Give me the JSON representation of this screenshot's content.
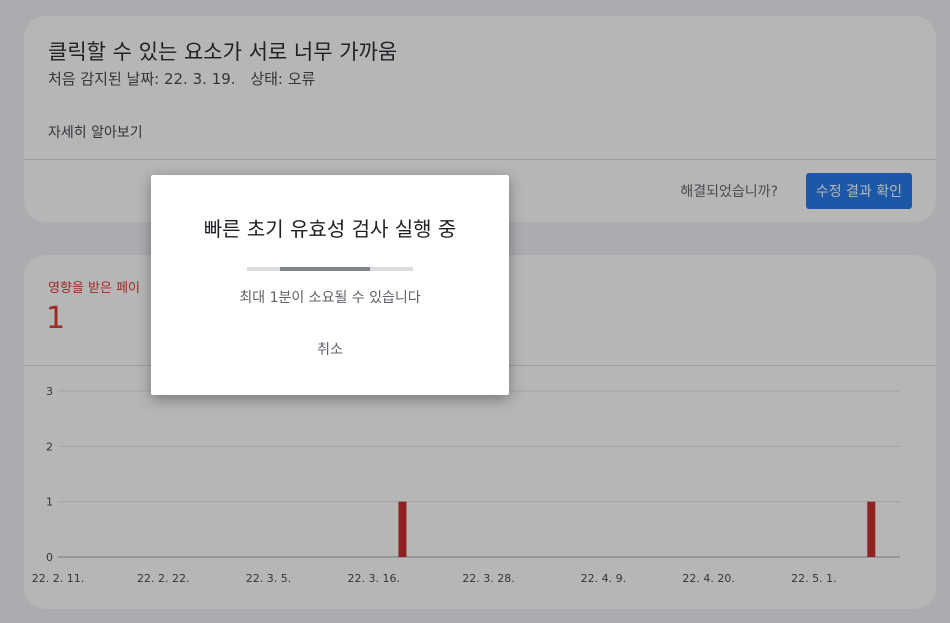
{
  "issue": {
    "title": "클릭할 수 있는 요소가 서로 너무 가까움",
    "first_detected": "처음 감지된 날짜: 22. 3. 19.",
    "status": "상태: 오류",
    "learn_more": "자세히 알아보기",
    "resolved_question": "해결되었습니까?",
    "validate_button": "수정 결과 확인"
  },
  "affected": {
    "label": "영향을 받은 페이",
    "count": "1"
  },
  "colors": {
    "accent": "#1a73e8",
    "error": "#d93025",
    "bar": "#c5221f"
  },
  "chart_data": {
    "type": "bar",
    "x_ticks": [
      "22. 2. 11.",
      "22. 2. 22.",
      "22. 3. 5.",
      "22. 3. 16.",
      "22. 3. 28.",
      "22. 4. 9.",
      "22. 4. 20.",
      "22. 5. 1."
    ],
    "y_ticks": [
      0,
      1,
      2,
      3
    ],
    "ylim": [
      0,
      3
    ],
    "xlim": [
      "22. 2. 11.",
      "22. 5. 10."
    ],
    "bars": [
      {
        "date": "22. 3. 19.",
        "value": 1
      },
      {
        "date": "22. 5. 7.",
        "value": 1
      }
    ],
    "grid": true
  },
  "dialog": {
    "title": "빠른 초기 유효성 검사 실행 중",
    "subtitle": "최대 1분이 소요될 수 있습니다",
    "cancel": "취소",
    "progress_start": 0.2,
    "progress_end": 0.74
  }
}
